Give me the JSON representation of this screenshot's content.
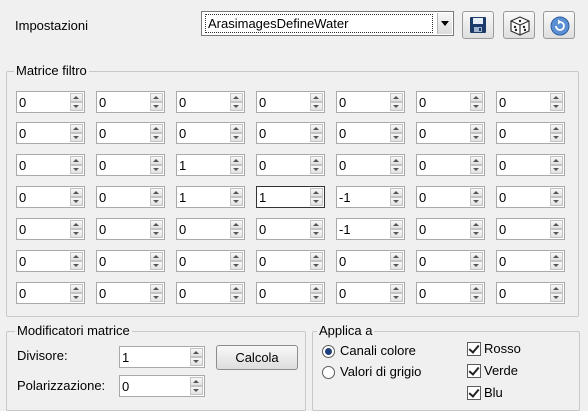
{
  "header": {
    "label": "Impostazioni",
    "preset_value": "ArasimagesDefineWater"
  },
  "toolbar": {
    "save_icon": "save-icon",
    "random_icon": "dice-icon",
    "reset_icon": "reset-icon"
  },
  "matrix": {
    "title": "Matrice filtro",
    "rows": [
      [
        "0",
        "0",
        "0",
        "0",
        "0",
        "0",
        "0"
      ],
      [
        "0",
        "0",
        "0",
        "0",
        "0",
        "0",
        "0"
      ],
      [
        "0",
        "0",
        "1",
        "0",
        "0",
        "0",
        "0"
      ],
      [
        "0",
        "0",
        "1",
        "1",
        "-1",
        "0",
        "0"
      ],
      [
        "0",
        "0",
        "0",
        "0",
        "-1",
        "0",
        "0"
      ],
      [
        "0",
        "0",
        "0",
        "0",
        "0",
        "0",
        "0"
      ],
      [
        "0",
        "0",
        "0",
        "0",
        "0",
        "0",
        "0"
      ]
    ]
  },
  "modifiers": {
    "title": "Modificatori matrice",
    "divisor_label": "Divisore:",
    "divisor_value": "1",
    "bias_label": "Polarizzazione:",
    "bias_value": "0",
    "compute_label": "Calcola"
  },
  "apply": {
    "title": "Applica a",
    "color_channels_label": "Canali colore",
    "gray_values_label": "Valori di grigio",
    "selected": "color",
    "red_label": "Rosso",
    "green_label": "Verde",
    "blue_label": "Blu",
    "red_checked": true,
    "green_checked": true,
    "blue_checked": true
  },
  "colors": {
    "background": "#f0f0f0",
    "radio_dot": "#1d3f7a"
  }
}
